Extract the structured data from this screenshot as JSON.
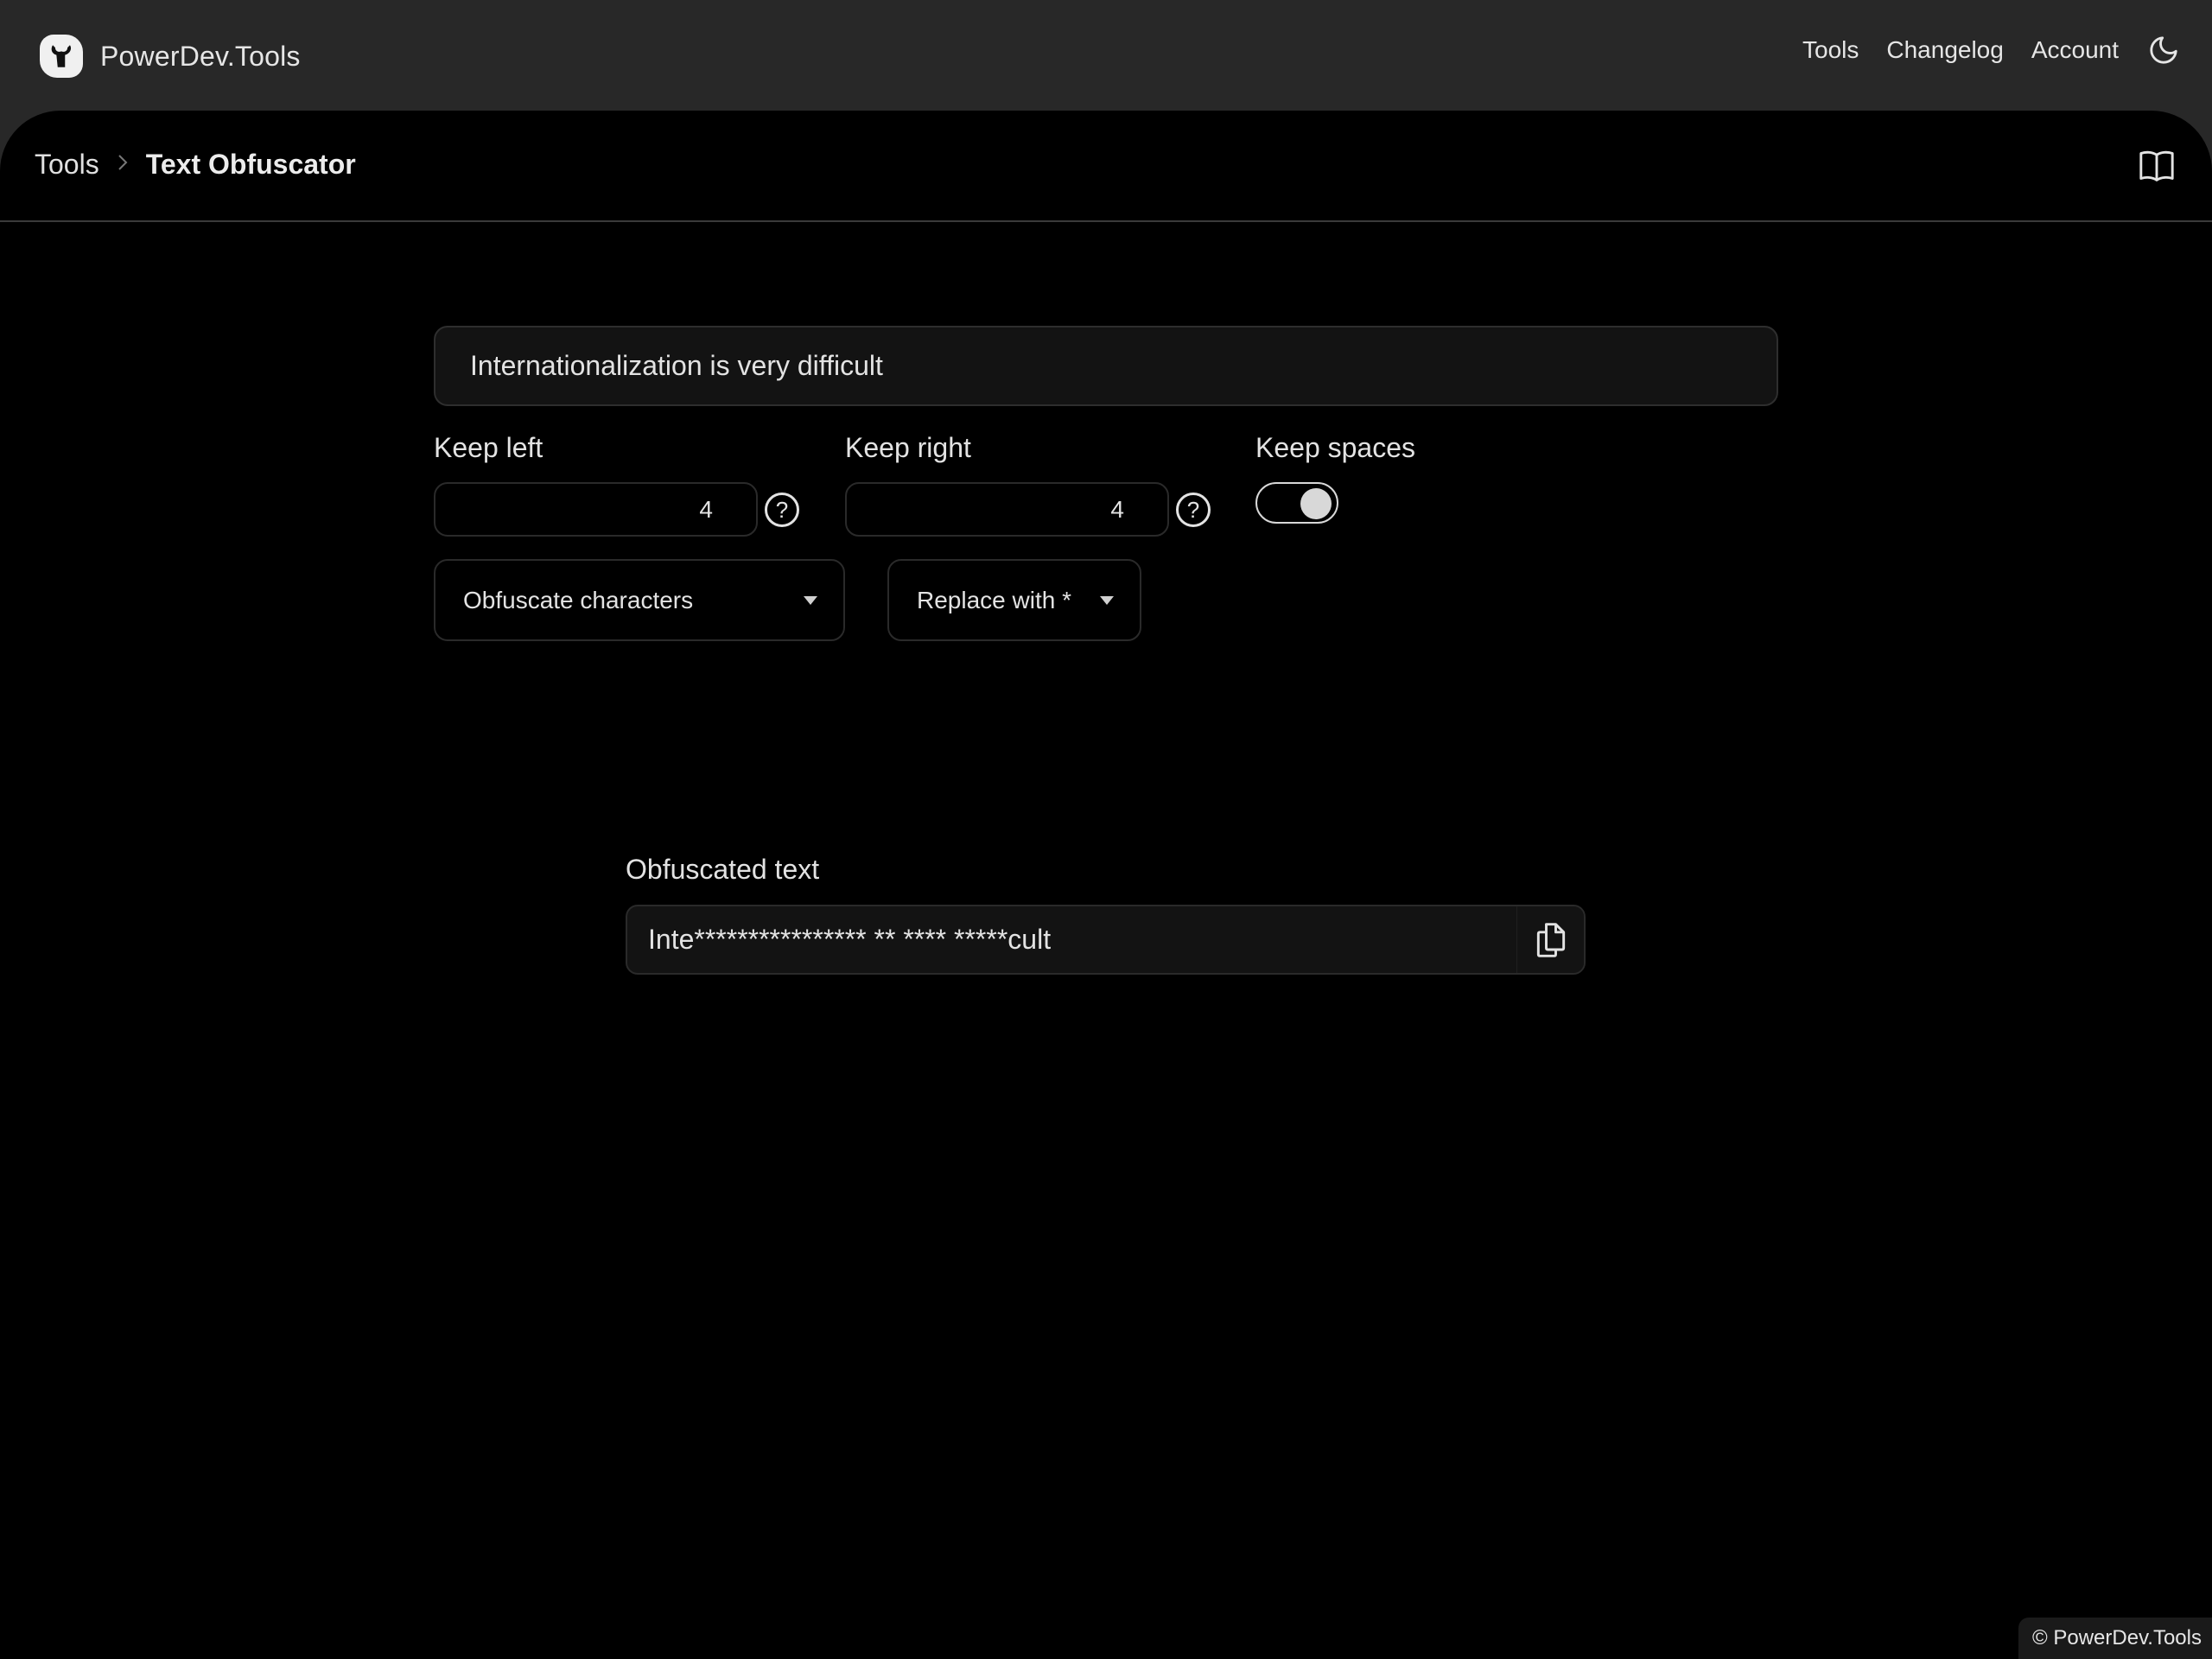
{
  "app": {
    "brand": "PowerDev.Tools",
    "logo_icon": "wrench-icon"
  },
  "nav": {
    "items": [
      {
        "label": "Tools"
      },
      {
        "label": "Changelog"
      },
      {
        "label": "Account"
      }
    ],
    "theme_icon": "moon-icon"
  },
  "breadcrumb": {
    "parent": "Tools",
    "separator_icon": "chevron-right-icon",
    "current": "Text Obfuscator"
  },
  "docs_icon": "book-icon",
  "form": {
    "source_text": "Internationalization is very difficult",
    "keep_left": {
      "label": "Keep left",
      "value": "4",
      "help_icon": "question-circle-icon"
    },
    "keep_right": {
      "label": "Keep right",
      "value": "4",
      "help_icon": "question-circle-icon"
    },
    "keep_spaces": {
      "label": "Keep spaces",
      "enabled": true
    },
    "mode_select": {
      "selected": "Obfuscate characters"
    },
    "replace_select": {
      "selected": "Replace with *"
    }
  },
  "output": {
    "label": "Obfuscated text",
    "value": "Inte**************** ** **** *****cult",
    "copy_icon": "copy-icon"
  },
  "footer": {
    "text": "© PowerDev.Tools"
  },
  "colors": {
    "topbar_bg": "#282828",
    "panel_bg": "#000000",
    "input_bg": "#131313",
    "text": "#e3e3e3"
  }
}
